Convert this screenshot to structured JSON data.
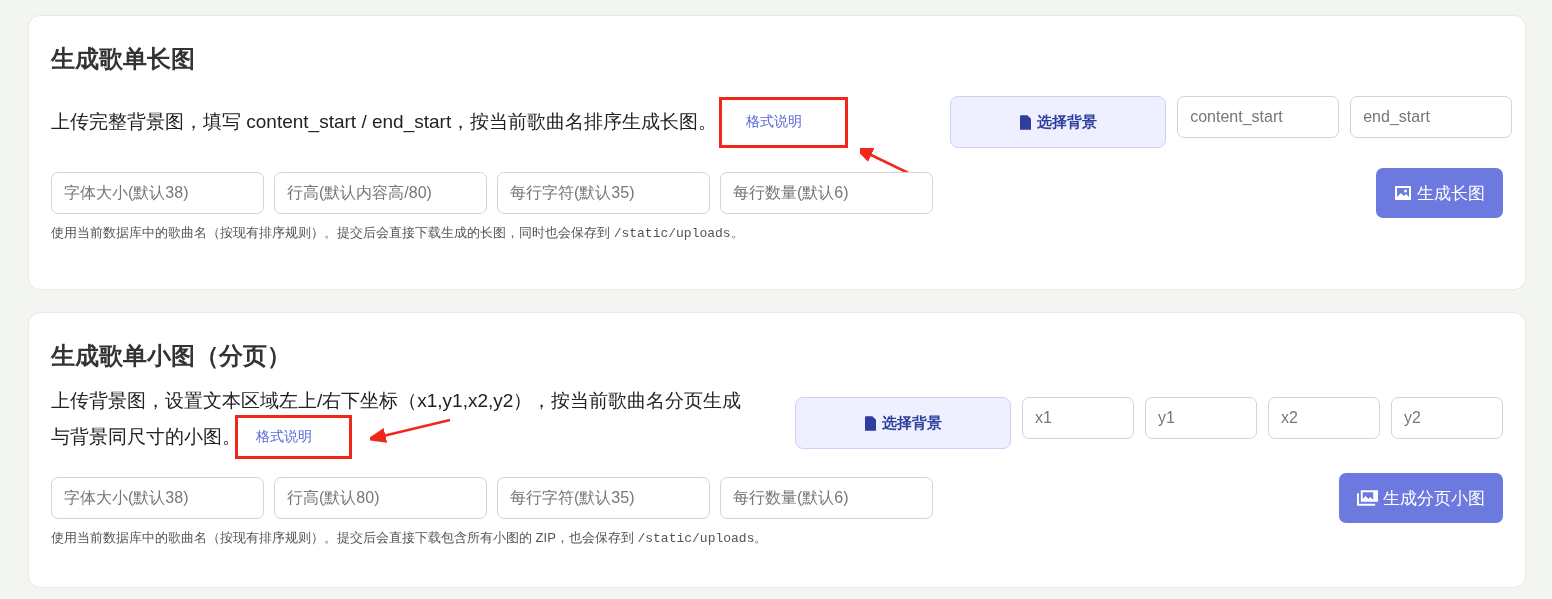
{
  "sections": [
    {
      "title": "生成歌单长图",
      "description_lines": [
        "上传完整背景图，填写 content_start / end_start，按当前歌曲名排序生成长图。"
      ],
      "link": "格式说明",
      "choose_button": "选择背景",
      "fields": [
        {
          "placeholder": "content_start"
        },
        {
          "placeholder": "end_start"
        }
      ],
      "options": [
        {
          "placeholder": "字体大小(默认38)"
        },
        {
          "placeholder": "行高(默认内容高/80)"
        },
        {
          "placeholder": "每行字符(默认35)"
        },
        {
          "placeholder": "每行数量(默认6)"
        }
      ],
      "submit": {
        "label": "生成长图",
        "kind": "single"
      },
      "hint": {
        "text": "使用当前数据库中的歌曲名（按现有排序规则）。提交后会直接下载生成的长图，同时也会保存到 ",
        "code": "/static/uploads",
        "end": "。"
      }
    },
    {
      "title": "生成歌单小图（分页）",
      "description_lines": [
        "上传背景图，设置文本区域左上/右下坐标（x1,y1,x2,y2），按当前歌曲名分页生成",
        "与背景同尺寸的小图。"
      ],
      "link": "格式说明",
      "choose_button": "选择背景",
      "fields": [
        {
          "placeholder": "x1"
        },
        {
          "placeholder": "y1"
        },
        {
          "placeholder": "x2"
        },
        {
          "placeholder": "y2"
        }
      ],
      "options": [
        {
          "placeholder": "字体大小(默认38)"
        },
        {
          "placeholder": "行高(默认80)"
        },
        {
          "placeholder": "每行字符(默认35)"
        },
        {
          "placeholder": "每行数量(默认6)"
        }
      ],
      "submit": {
        "label": "生成分页小图",
        "kind": "multiple"
      },
      "hint": {
        "text": "使用当前数据库中的歌曲名（按现有排序规则）。提交后会直接下载包含所有小图的 ZIP，也会保存到 ",
        "code": "/static/uploads",
        "end": "。"
      }
    }
  ]
}
